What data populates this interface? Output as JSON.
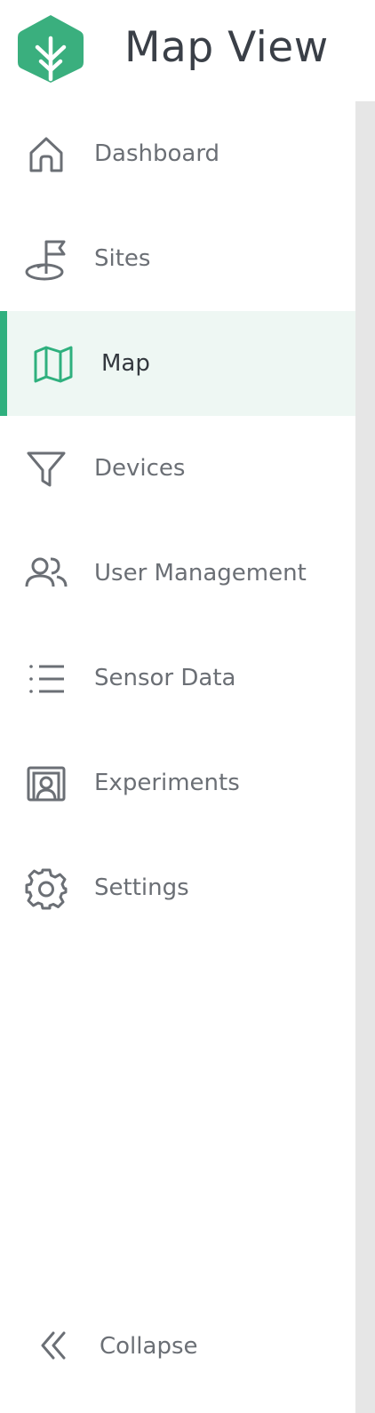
{
  "app": {
    "title": "Map View",
    "brand_color": "#3aaf7e"
  },
  "sidebar": {
    "items": [
      {
        "label": "Dashboard",
        "icon": "home-icon",
        "active": false
      },
      {
        "label": "Sites",
        "icon": "flag-icon",
        "active": false
      },
      {
        "label": "Map",
        "icon": "map-icon",
        "active": true
      },
      {
        "label": "Devices",
        "icon": "filter-icon",
        "active": false
      },
      {
        "label": "User Management",
        "icon": "users-icon",
        "active": false
      },
      {
        "label": "Sensor Data",
        "icon": "list-icon",
        "active": false
      },
      {
        "label": "Experiments",
        "icon": "experiments-icon",
        "active": false
      },
      {
        "label": "Settings",
        "icon": "gear-icon",
        "active": false
      }
    ],
    "active_color": "#2fb07e",
    "active_background": "#eef7f3",
    "collapse_label": "Collapse",
    "collapse_icon": "chevrons-left-icon"
  }
}
